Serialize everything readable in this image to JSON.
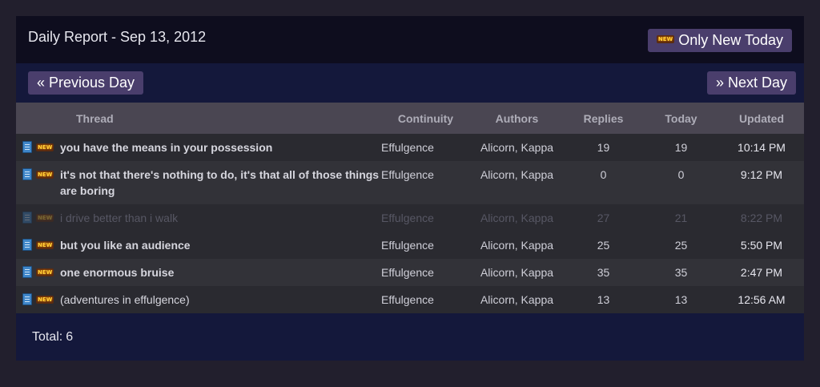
{
  "header": {
    "title": "Daily Report - Sep 13, 2012",
    "new_button_label": "Only New Today",
    "new_badge": "NEW"
  },
  "nav": {
    "prev_label": "« Previous Day",
    "next_label": "» Next Day"
  },
  "table": {
    "columns": [
      "Thread",
      "Continuity",
      "Authors",
      "Replies",
      "Today",
      "Updated"
    ],
    "rows": [
      {
        "thread": "you have the means in your possession",
        "continuity": "Effulgence",
        "authors": "Alicorn, Kappa",
        "replies": "19",
        "today": "19",
        "updated": "10:14 PM",
        "badge": "NEW",
        "icon": "document-icon"
      },
      {
        "thread": "it's not that there's nothing to do, it's that all of those things are boring",
        "continuity": "Effulgence",
        "authors": "Alicorn, Kappa",
        "replies": "0",
        "today": "0",
        "updated": "9:12 PM",
        "badge": "NEW",
        "icon": "document-icon"
      },
      {
        "thread": "i drive better than i walk",
        "continuity": "Effulgence",
        "authors": "Alicorn, Kappa",
        "replies": "27",
        "today": "21",
        "updated": "8:22 PM",
        "badge": "NEW",
        "icon": "document-icon"
      },
      {
        "thread": "but you like an audience",
        "continuity": "Effulgence",
        "authors": "Alicorn, Kappa",
        "replies": "25",
        "today": "25",
        "updated": "5:50 PM",
        "badge": "NEW",
        "icon": "document-icon"
      },
      {
        "thread": "one enormous bruise",
        "continuity": "Effulgence",
        "authors": "Alicorn, Kappa",
        "replies": "35",
        "today": "35",
        "updated": "2:47 PM",
        "badge": "NEW",
        "icon": "document-icon"
      },
      {
        "thread": "(adventures in effulgence)",
        "continuity": "Effulgence",
        "authors": "Alicorn, Kappa",
        "replies": "13",
        "today": "13",
        "updated": "12:56 AM",
        "badge": "NEW",
        "icon": "document-icon"
      }
    ]
  },
  "footer": {
    "total_label": "Total:",
    "total_value": "6"
  },
  "colors": {
    "background": "#221f2d",
    "button": "#4a3e6c",
    "header_bg": "#0e0d1e",
    "nav_bg": "#14183b",
    "table_header_bg": "#4a4652"
  }
}
